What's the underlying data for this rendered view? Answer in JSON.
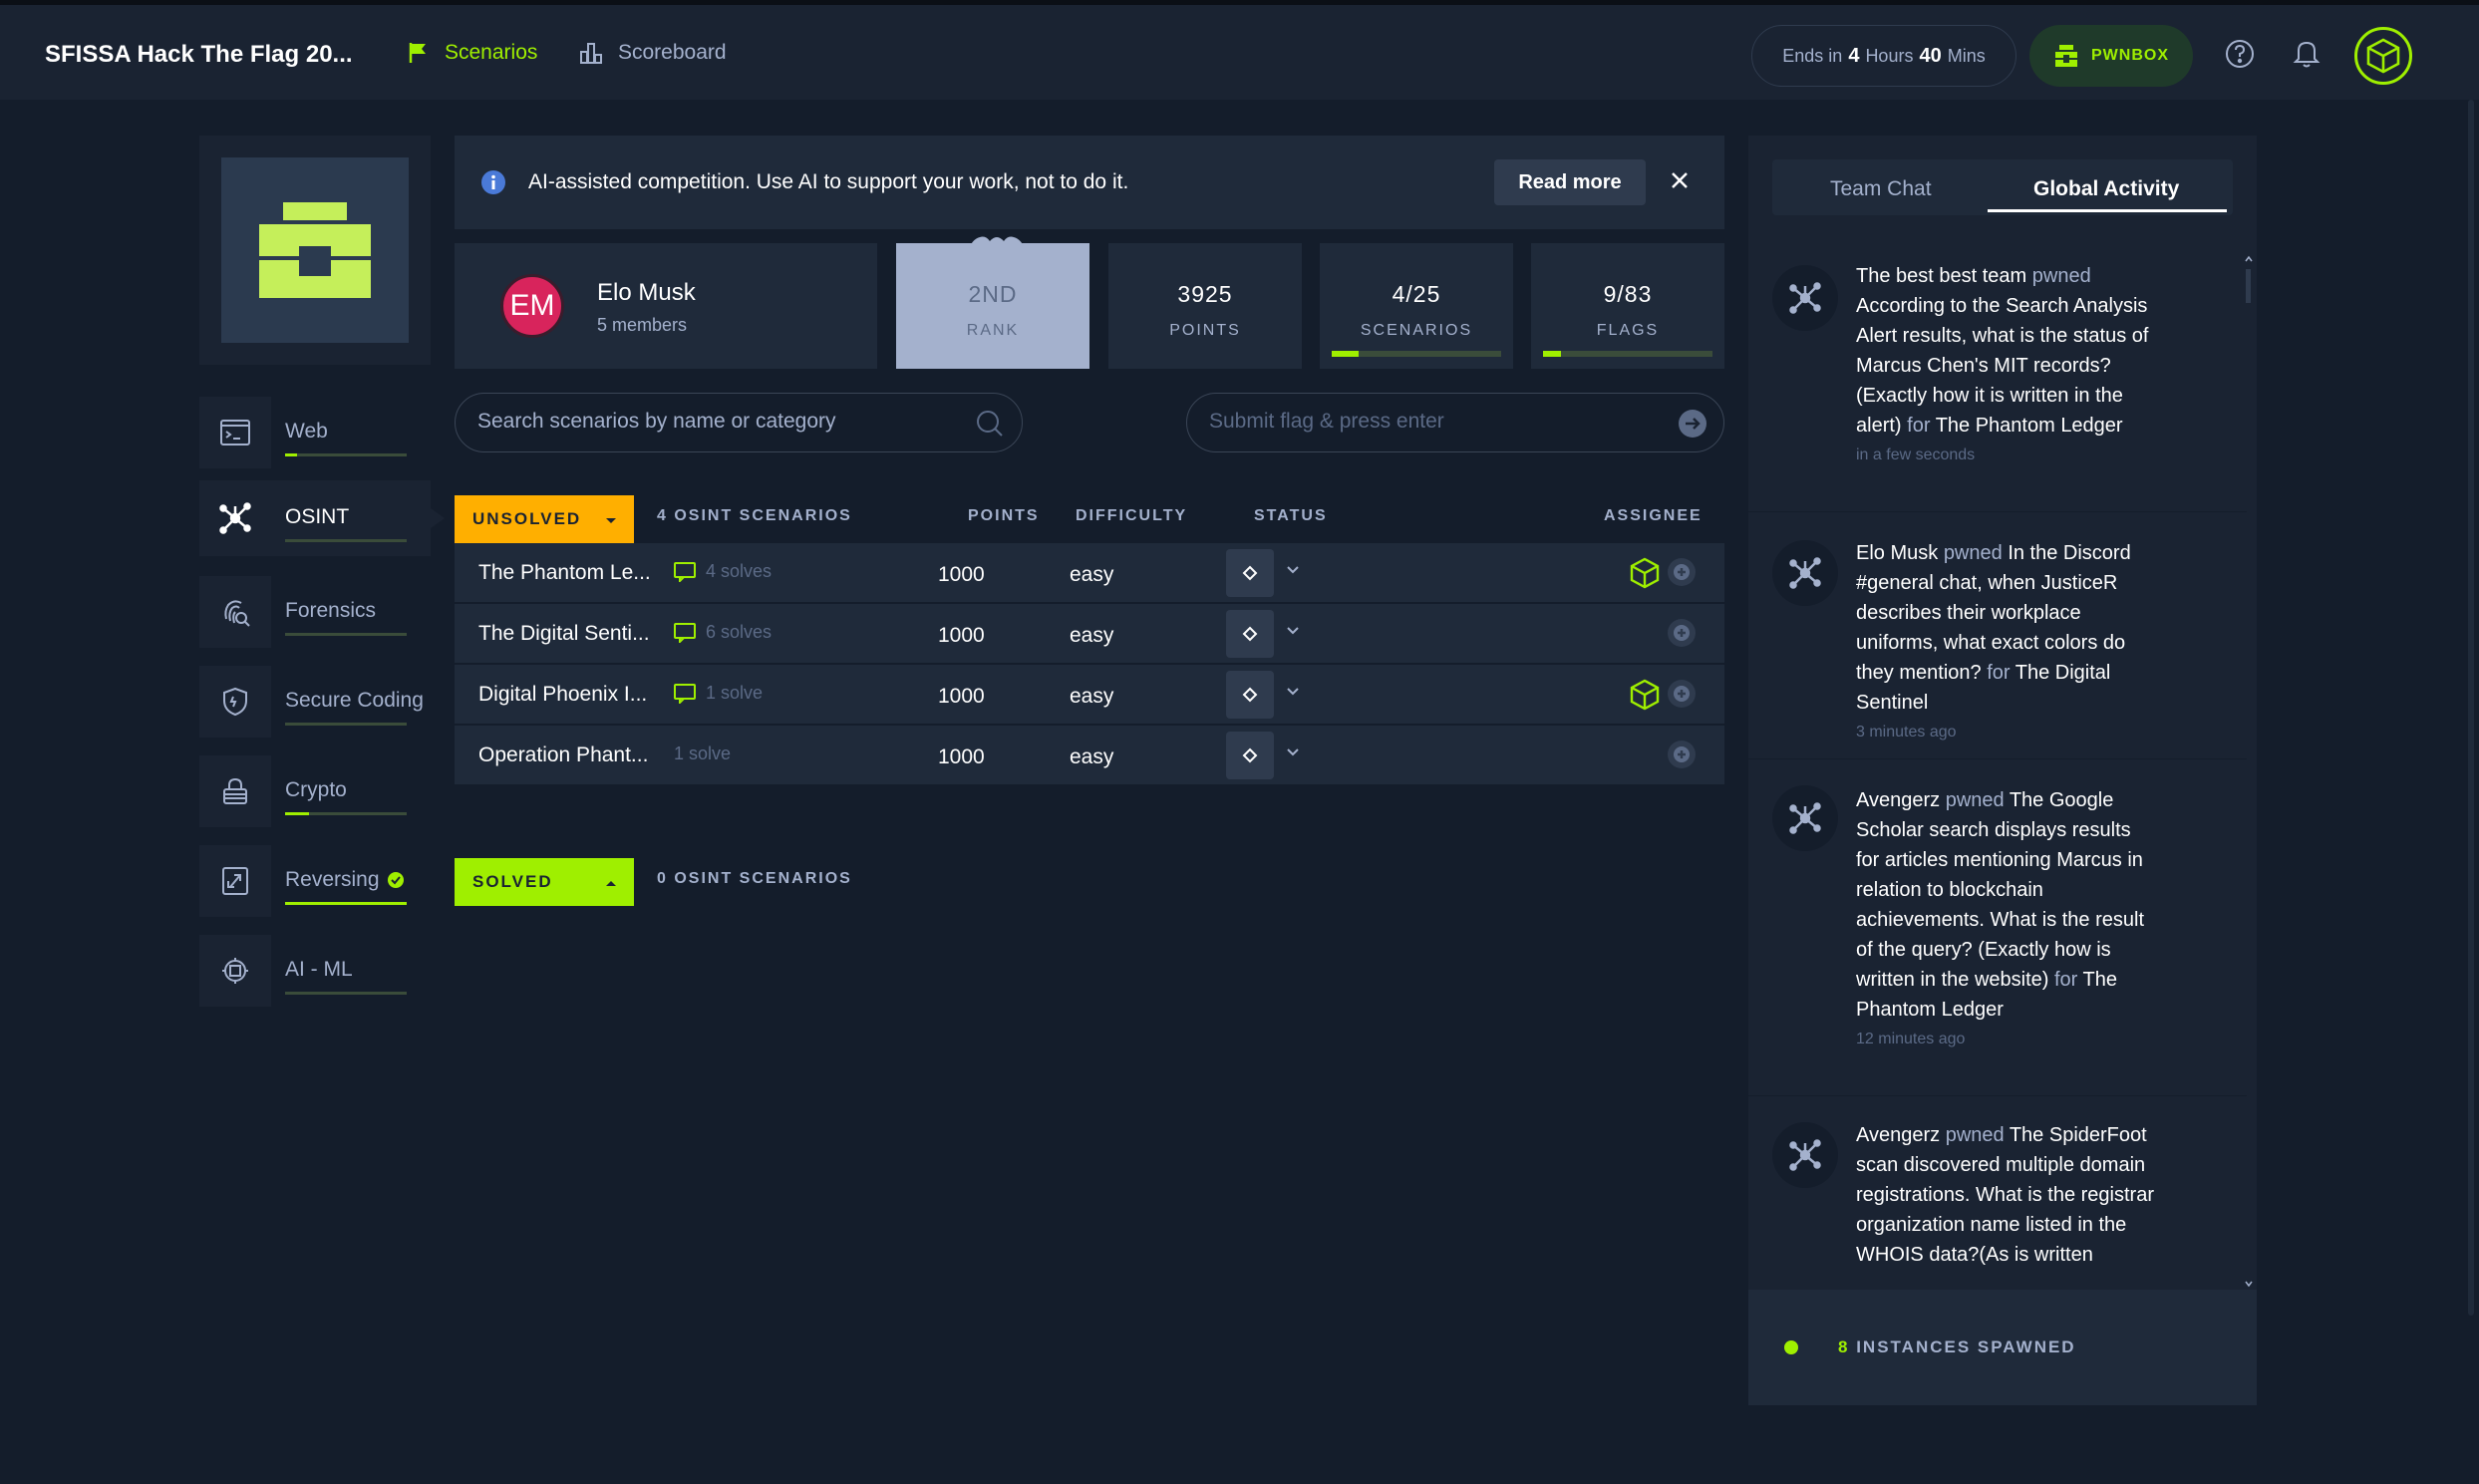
{
  "header": {
    "app_title": "SFISSA Hack The Flag 20...",
    "nav": [
      {
        "label": "Scenarios",
        "icon": "flag-icon",
        "active": true
      },
      {
        "label": "Scoreboard",
        "icon": "scoreboard-icon",
        "active": false
      }
    ],
    "timer": {
      "prefix": "Ends in",
      "hours": "4",
      "hours_unit": "Hours",
      "mins": "40",
      "mins_unit": "Mins"
    },
    "pwnbox_label": "PWNBOX",
    "accent": "#9fef00"
  },
  "sidebar": {
    "categories": [
      {
        "label": "Web",
        "icon": "terminal-icon",
        "active": false,
        "solved": false,
        "progress": 0.1
      },
      {
        "label": "OSINT",
        "icon": "network-icon",
        "active": true,
        "solved": false,
        "progress": 0.0
      },
      {
        "label": "Forensics",
        "icon": "fingerprint-icon",
        "active": false,
        "solved": false,
        "progress": 0.0
      },
      {
        "label": "Secure Coding",
        "icon": "shield-icon",
        "active": false,
        "solved": false,
        "progress": 0.0
      },
      {
        "label": "Crypto",
        "icon": "lock-icon",
        "active": false,
        "solved": false,
        "progress": 0.2
      },
      {
        "label": "Reversing",
        "icon": "reverse-icon",
        "active": false,
        "solved": true,
        "progress": 1.0
      },
      {
        "label": "AI - ML",
        "icon": "chip-icon",
        "active": false,
        "solved": false,
        "progress": 0.0
      }
    ]
  },
  "banner": {
    "text": "AI-assisted competition. Use AI to support your work, not to do it.",
    "read_more": "Read more"
  },
  "team": {
    "initials": "EM",
    "name": "Elo Musk",
    "members": "5 members",
    "avatar_color": "#d8245c"
  },
  "stats": {
    "rank": {
      "value": "2ND",
      "label": "RANK"
    },
    "points": {
      "value": "3925",
      "label": "POINTS"
    },
    "scenarios": {
      "value": "4/25",
      "label": "SCENARIOS",
      "progress": 0.16
    },
    "flags": {
      "value": "9/83",
      "label": "FLAGS",
      "progress": 0.108
    }
  },
  "search": {
    "placeholder": "Search scenarios by name or category"
  },
  "flag_input": {
    "placeholder": "Submit flag & press enter"
  },
  "unsolved": {
    "dropdown_label": "UNSOLVED",
    "count_label": "4 OSINT SCENARIOS",
    "columns": {
      "points": "POINTS",
      "difficulty": "DIFFICULTY",
      "status": "STATUS",
      "assignee": "ASSIGNEE"
    },
    "rows": [
      {
        "name": "The Phantom Le...",
        "solves": "4 solves",
        "writeup": true,
        "points": "1000",
        "difficulty": "easy",
        "assigned": true
      },
      {
        "name": "The Digital Senti...",
        "solves": "6 solves",
        "writeup": true,
        "points": "1000",
        "difficulty": "easy",
        "assigned": false
      },
      {
        "name": "Digital Phoenix I...",
        "solves": "1 solve",
        "writeup": true,
        "points": "1000",
        "difficulty": "easy",
        "assigned": true
      },
      {
        "name": "Operation Phant...",
        "solves": "1 solve",
        "writeup": false,
        "points": "1000",
        "difficulty": "easy",
        "assigned": false
      }
    ]
  },
  "solved": {
    "dropdown_label": "SOLVED",
    "count_label": "0 OSINT SCENARIOS"
  },
  "right_panel": {
    "tabs": [
      {
        "label": "Team Chat",
        "active": false
      },
      {
        "label": "Global Activity",
        "active": true
      }
    ],
    "feed": [
      {
        "actor": "The best best team",
        "verb": "pwned",
        "text": "According to the Search Analysis Alert results, what is the status of Marcus Chen's MIT records? (Exactly how it is written in the alert)",
        "for_word": "for",
        "target": "The Phantom Ledger",
        "time": "in a few seconds"
      },
      {
        "actor": "Elo Musk",
        "verb": "pwned",
        "text": "In the Discord #general chat, when JusticeR describes their workplace uniforms, what exact colors do they mention?",
        "for_word": "for",
        "target": "The Digital Sentinel",
        "time": "3 minutes ago"
      },
      {
        "actor": "Avengerz",
        "verb": "pwned",
        "text": "The Google Scholar search displays results for articles mentioning Marcus in relation to blockchain achievements. What is the result of the query? (Exactly how is written in the website)",
        "for_word": "for",
        "target": "The Phantom Ledger",
        "time": "12 minutes ago"
      },
      {
        "actor": "Avengerz",
        "verb": "pwned",
        "text": "The SpiderFoot scan discovered multiple domain registrations. What is the registrar organization name listed in the WHOIS data?(As is written",
        "for_word": "",
        "target": "",
        "time": ""
      }
    ],
    "instances": {
      "count": "8",
      "label": "INSTANCES SPAWNED"
    }
  }
}
